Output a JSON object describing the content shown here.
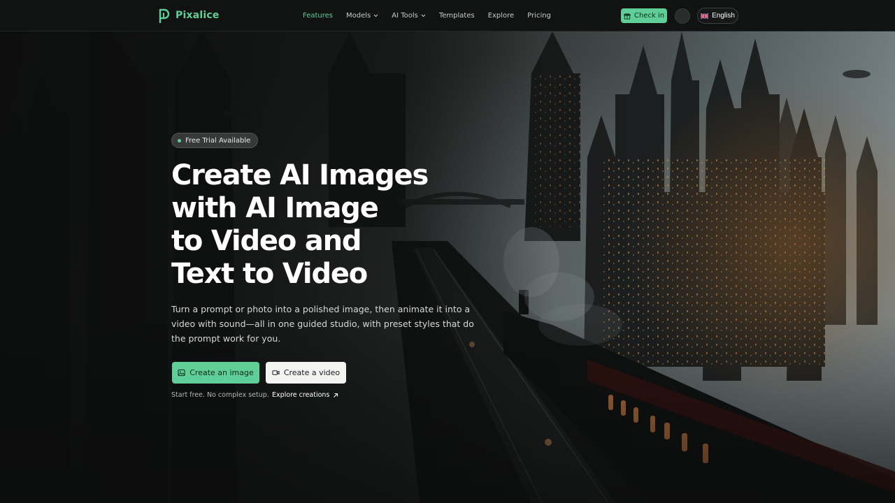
{
  "brand": {
    "name": "Pixalice",
    "accent": "#5fcf97"
  },
  "nav": {
    "links": [
      {
        "label": "Features",
        "active": true,
        "dropdown": false
      },
      {
        "label": "Models",
        "active": false,
        "dropdown": true
      },
      {
        "label": "AI Tools",
        "active": false,
        "dropdown": true
      },
      {
        "label": "Templates",
        "active": false,
        "dropdown": false
      },
      {
        "label": "Explore",
        "active": false,
        "dropdown": false
      },
      {
        "label": "Pricing",
        "active": false,
        "dropdown": false
      }
    ],
    "checkin_label": "Check in",
    "checkin_icon": "gift-icon",
    "language_label": "English",
    "language_icon": "uk-flag-icon"
  },
  "hero": {
    "badge": "Free Trial Available",
    "title_lines": [
      "Create AI Images",
      "with AI Image",
      "to Video and",
      "Text to Video"
    ],
    "description": "Turn a prompt or photo into a polished image, then animate it into a video with sound—all in one guided studio, with preset styles that do the prompt work for you.",
    "primary_cta": "Create an image",
    "primary_cta_icon": "image-icon",
    "secondary_cta": "Create a video",
    "secondary_cta_icon": "video-camera-icon",
    "note": "Start free. No complex setup.",
    "explore_link": "Explore creations",
    "explore_icon": "arrow-up-right-icon"
  }
}
